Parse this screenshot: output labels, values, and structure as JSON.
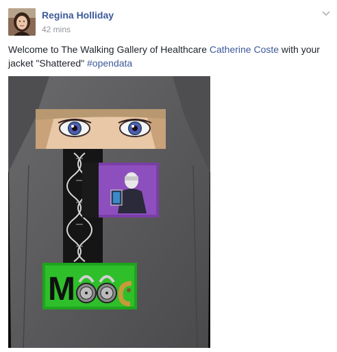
{
  "post": {
    "author": "Regina Holliday",
    "timestamp": "42 mins",
    "text_before": "Welcome to The Walking Gallery of Healthcare ",
    "mention": "Catherine Coste",
    "text_middle": " with your jacket \"Shattered\" ",
    "hashtag": "#opendata",
    "photo_letter": "M",
    "menu_icon": "chevron-down-icon"
  },
  "colors": {
    "link": "#3b5998",
    "text": "#1d2129",
    "meta": "#90949c",
    "jacket": "#5a5a5c",
    "purple_panel": "#7a3fa6",
    "green_panel": "#2fbf2a"
  }
}
